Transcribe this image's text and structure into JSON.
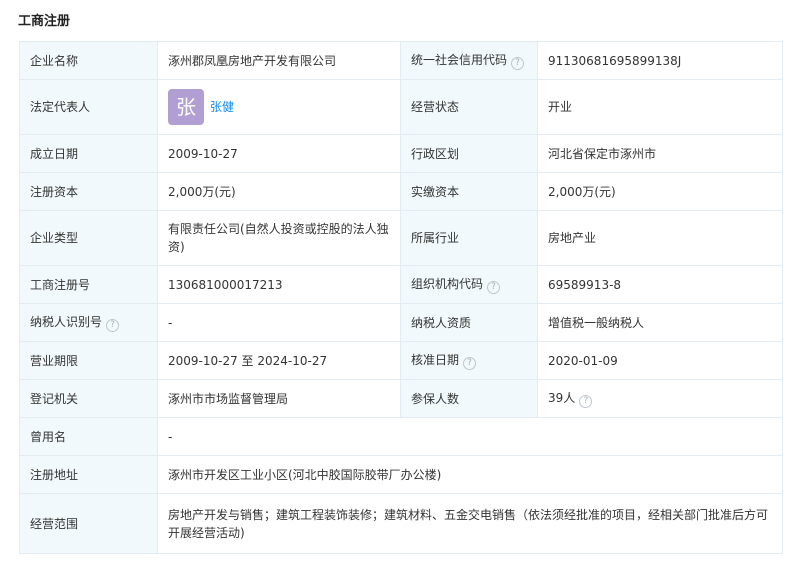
{
  "section_title": "工商注册",
  "rows": {
    "r1": {
      "l1": "企业名称",
      "v1": "涿州郡凤凰房地产开发有限公司",
      "l2": "统一社会信用代码",
      "v2": "91130681695899138J"
    },
    "r2": {
      "l1": "法定代表人",
      "avatar_char": "张",
      "person": "张健",
      "l2": "经营状态",
      "v2": "开业"
    },
    "r3": {
      "l1": "成立日期",
      "v1": "2009-10-27",
      "l2": "行政区划",
      "v2": "河北省保定市涿州市"
    },
    "r4": {
      "l1": "注册资本",
      "v1": "2,000万(元)",
      "l2": "实缴资本",
      "v2": "2,000万(元)"
    },
    "r5": {
      "l1": "企业类型",
      "v1": "有限责任公司(自然人投资或控股的法人独资)",
      "l2": "所属行业",
      "v2": "房地产业"
    },
    "r6": {
      "l1": "工商注册号",
      "v1": "130681000017213",
      "l2": "组织机构代码",
      "v2": "69589913-8"
    },
    "r7": {
      "l1": "纳税人识别号",
      "v1": "-",
      "l2": "纳税人资质",
      "v2": "增值税一般纳税人"
    },
    "r8": {
      "l1": "营业期限",
      "v1": "2009-10-27 至 2024-10-27",
      "l2": "核准日期",
      "v2": "2020-01-09"
    },
    "r9": {
      "l1": "登记机关",
      "v1": "涿州市市场监督管理局",
      "l2": "参保人数",
      "v2": "39人"
    },
    "r10": {
      "l1": "曾用名",
      "v1": "-"
    },
    "r11": {
      "l1": "注册地址",
      "v1": "涿州市开发区工业小区(河北中胶国际胶带厂办公楼)"
    },
    "r12": {
      "l1": "经营范围",
      "v1": "房地产开发与销售；建筑工程装饰装修；建筑材料、五金交电销售（依法须经批准的项目，经相关部门批准后方可开展经营活动)"
    }
  },
  "help_glyph": "?",
  "colors": {
    "label_bg": "#f2f9fc",
    "border": "#e4ecf3",
    "link": "#128bed",
    "avatar": "#b19ed2"
  }
}
